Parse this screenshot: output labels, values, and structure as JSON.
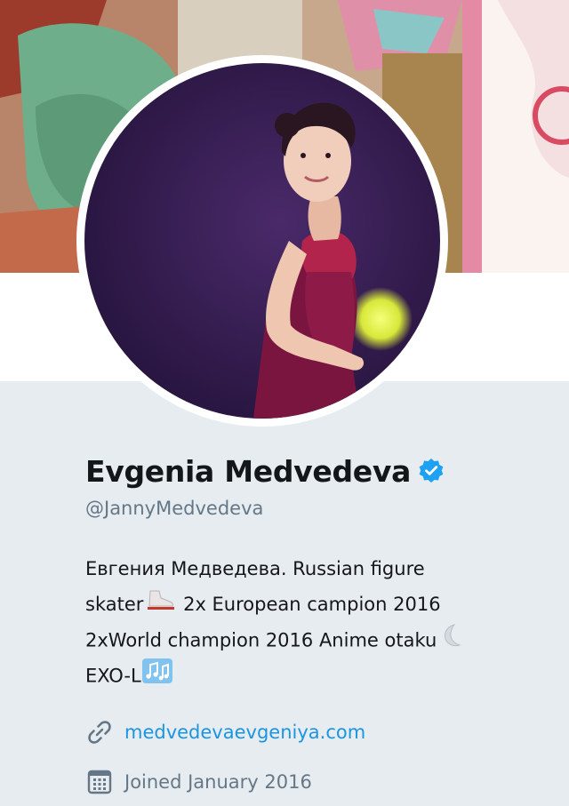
{
  "profile": {
    "display_name": "Evgenia Medvedeva",
    "verified": true,
    "verified_icon": "verified-badge-icon",
    "handle": "@JannyMedvedeva",
    "bio_lines": [
      "Евгения Медведева. Russian figure",
      "skater",
      "2x European campion 2016",
      "2xWorld champion 2016 Anime otaku",
      "EXO-L"
    ],
    "bio_emojis": [
      "ice-skate-icon",
      "crescent-moon-icon",
      "musical-notes-icon"
    ],
    "website": "medvedevaevgeniya.com",
    "website_icon": "link-icon",
    "joined": "Joined January 2016",
    "joined_icon": "calendar-icon"
  },
  "colors": {
    "link": "#1b95e0",
    "secondary_text": "#657786",
    "primary_text": "#14171a",
    "panel_bg": "#e6ecf0",
    "verified": "#1da1f2"
  }
}
